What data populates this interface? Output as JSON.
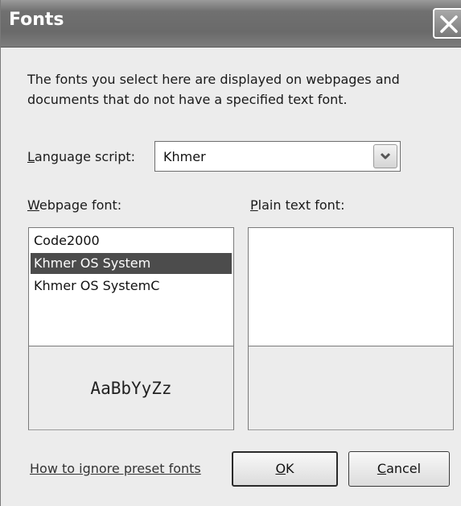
{
  "window": {
    "title": "Fonts",
    "close_icon": "close-icon"
  },
  "description": "The fonts you select here are displayed on webpages and documents that do not have a specified text font.",
  "language_script": {
    "label": "Language script:",
    "value": "Khmer"
  },
  "webpage_font": {
    "label": "Webpage font:",
    "items": [
      "Code2000",
      "Khmer OS System",
      "Khmer OS SystemC"
    ],
    "selected": "Khmer OS System",
    "preview": "AaBbYyZz"
  },
  "plain_text_font": {
    "label": "Plain text font:",
    "items": [],
    "preview": ""
  },
  "footer": {
    "help_link": "How to ignore preset fonts",
    "ok_label": "OK",
    "cancel_label": "Cancel"
  },
  "colors": {
    "titlebar": "#6a6a6a",
    "selection": "#4c4c4c",
    "dialog_bg": "#ececec"
  }
}
